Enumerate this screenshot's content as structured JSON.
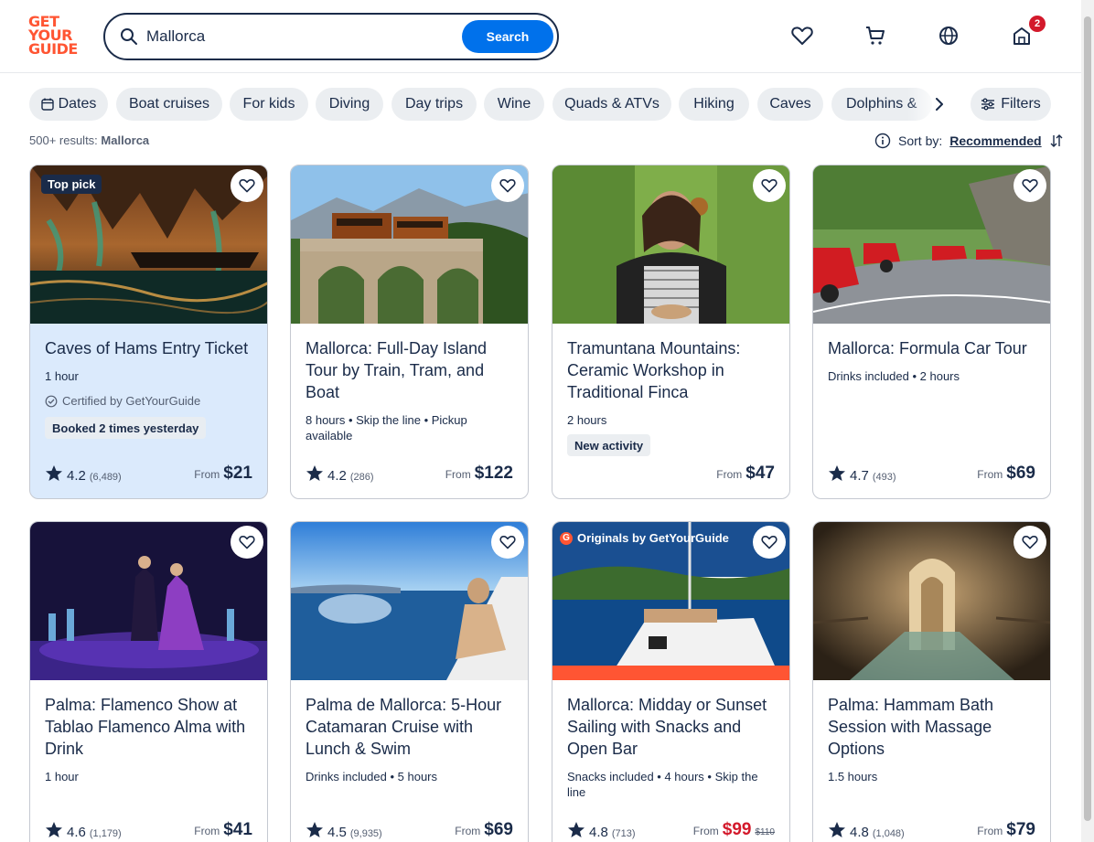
{
  "logo": {
    "line1": "GET",
    "line2": "YOUR",
    "line3": "GUIDE"
  },
  "search": {
    "value": "Mallorca",
    "button": "Search"
  },
  "header": {
    "cart_badge": "2"
  },
  "chips": [
    "Dates",
    "Boat cruises",
    "For kids",
    "Diving",
    "Day trips",
    "Wine",
    "Quads & ATVs",
    "Hiking",
    "Caves",
    "Dolphins &"
  ],
  "filters_label": "Filters",
  "results": {
    "count": "500+ results:",
    "query": "Mallorca"
  },
  "sort": {
    "label": "Sort by:",
    "value": "Recommended"
  },
  "cards": [
    {
      "badge": "Top pick",
      "title": "Caves of Hams Entry Ticket",
      "meta": "1 hour",
      "certified": "Certified by GetYourGuide",
      "pill": "Booked 2 times yesterday",
      "rating": "4.2",
      "reviews": "(6,489)",
      "from": "From",
      "price": "$21"
    },
    {
      "title": "Mallorca: Full-Day Island Tour by Train, Tram, and Boat",
      "meta": "8 hours • Skip the line • Pickup available",
      "rating": "4.2",
      "reviews": "(286)",
      "from": "From",
      "price": "$122"
    },
    {
      "title": "Tramuntana Mountains: Ceramic Workshop in Traditional Finca",
      "meta": "2 hours",
      "pill": "New activity",
      "from": "From",
      "price": "$47"
    },
    {
      "title": "Mallorca: Formula Car Tour",
      "meta": "Drinks included • 2 hours",
      "rating": "4.7",
      "reviews": "(493)",
      "from": "From",
      "price": "$69"
    },
    {
      "title": "Palma: Flamenco Show at Tablao Flamenco Alma with Drink",
      "meta": "1 hour",
      "rating": "4.6",
      "reviews": "(1,179)",
      "from": "From",
      "price": "$41"
    },
    {
      "title": "Palma de Mallorca: 5-Hour Catamaran Cruise with Lunch & Swim",
      "meta": "Drinks included • 5 hours",
      "rating": "4.5",
      "reviews": "(9,935)",
      "from": "From",
      "price": "$69"
    },
    {
      "originals": "Originals by GetYourGuide",
      "title": "Mallorca: Midday or Sunset Sailing with Snacks and Open Bar",
      "meta": "Snacks included • 4 hours • Skip the line",
      "rating": "4.8",
      "reviews": "(713)",
      "from": "From",
      "price": "$99",
      "old_price": "$110"
    },
    {
      "title": "Palma: Hammam Bath Session with Massage Options",
      "meta": "1.5 hours",
      "rating": "4.8",
      "reviews": "(1,048)",
      "from": "From",
      "price": "$79"
    }
  ],
  "colors": {
    "accent": "#0071eb",
    "brand": "#ff5533",
    "text": "#1a2b49",
    "sale": "#d3192b"
  }
}
